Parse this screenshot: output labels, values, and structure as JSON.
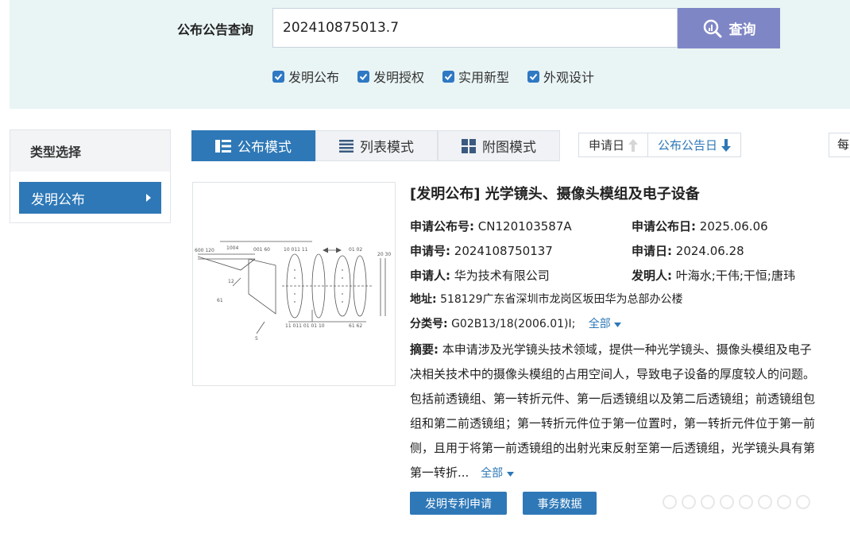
{
  "search": {
    "label": "公布公告查询",
    "value": "202410875013.7",
    "button_label": "查询"
  },
  "filters": [
    {
      "label": "发明公布",
      "checked": true
    },
    {
      "label": "发明授权",
      "checked": true
    },
    {
      "label": "实用新型",
      "checked": true
    },
    {
      "label": "外观设计",
      "checked": true
    }
  ],
  "sidebar": {
    "title": "类型选择",
    "items": [
      {
        "label": "发明公布",
        "selected": true
      }
    ]
  },
  "view_modes": [
    {
      "label": "公布模式",
      "icon": "list-detail-icon",
      "active": true
    },
    {
      "label": "列表模式",
      "icon": "list-icon",
      "active": false
    },
    {
      "label": "附图模式",
      "icon": "grid-icon",
      "active": false
    }
  ],
  "sort": {
    "apply_date": {
      "label": "申请日",
      "icon": "arrow-up-icon"
    },
    "pub_date": {
      "label": "公布公告日",
      "icon": "arrow-down-icon"
    },
    "per_page_label": "每"
  },
  "result": {
    "title": "[发明公布] 光学镜头、摄像头模组及电子设备",
    "pub_no_label": "申请公布号:",
    "pub_no": "CN120103587A",
    "pub_date_label": "申请公布日:",
    "pub_date": "2025.06.06",
    "app_no_label": "申请号:",
    "app_no": "2024108750137",
    "app_date_label": "申请日:",
    "app_date": "2024.06.28",
    "applicant_label": "申请人:",
    "applicant": "华为技术有限公司",
    "inventor_label": "发明人:",
    "inventor": "叶海水;干伟;干恒;唐玮",
    "address_label": "地址:",
    "address": "518129广东省深圳市龙岗区坂田华为总部办公楼",
    "class_label": "分类号:",
    "class_value": "G02B13/18(2006.01)I;",
    "class_more": "全部",
    "abstract_label": "摘要:",
    "abstract_lines": [
      "本申请涉及光学镜头技术领域，提供一种光学镜头、摄像头模组及电子",
      "决相关技术中的摄像头模组的占用空间人，导致电子设备的厚度较人的问题。",
      "包括前透镜组、第一转折元件、第一后透镜组以及第二后透镜组；前透镜组包",
      "组和第二前透镜组；第一转折元件位于第一位置时，第一转折元件位于第一前",
      "侧，且用于将第一前透镜组的出射光束反射至第一后透镜组，光学镜头具有第",
      "第一转折..."
    ],
    "abstract_more": "全部"
  },
  "actions": {
    "apply_button": "发明专利申请",
    "affairs_button": "事务数据"
  },
  "colors": {
    "primary": "#2e78b7",
    "search_button": "#7f86c6",
    "top_panel": "#e9f4f4"
  }
}
